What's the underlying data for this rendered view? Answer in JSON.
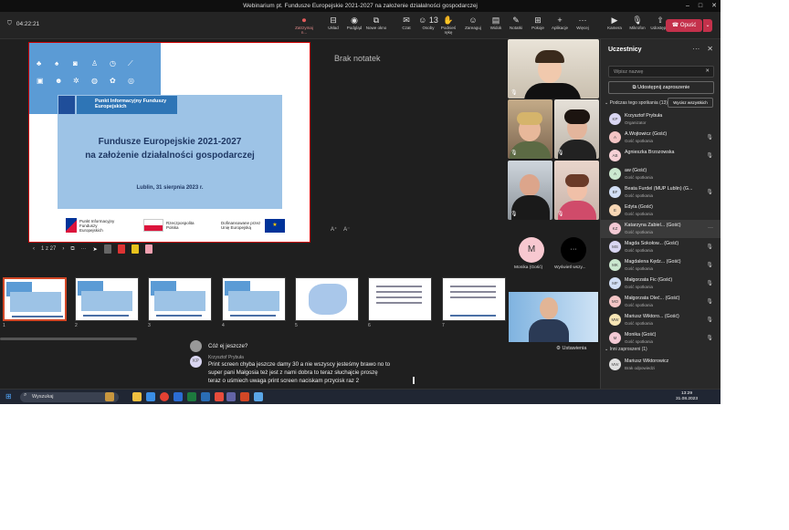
{
  "window": {
    "title": "Webinarium pt. Fundusze Europejskie 2021-2027 na założenie działalności gospodarczej"
  },
  "toolbar": {
    "timer": "04:22:21",
    "buttons": [
      {
        "label": "Zatrzymaj n...",
        "icon": "stop-recording-icon"
      },
      {
        "label": "Układ",
        "icon": "layout-icon"
      },
      {
        "label": "Podgląd",
        "icon": "preview-icon"
      },
      {
        "label": "Nowe okno",
        "icon": "new-window-icon"
      },
      {
        "label": "Czat",
        "icon": "chat-icon"
      },
      {
        "label": "Osoby",
        "icon": "people-icon",
        "badge": "13"
      },
      {
        "label": "Podnieś rękę",
        "icon": "raise-hand-icon"
      },
      {
        "label": "Zareaguj",
        "icon": "react-icon"
      },
      {
        "label": "Widok",
        "icon": "view-icon"
      },
      {
        "label": "Notatki",
        "icon": "notes-icon"
      },
      {
        "label": "Pokoje",
        "icon": "rooms-icon"
      },
      {
        "label": "Aplikacje",
        "icon": "apps-icon"
      },
      {
        "label": "Więcej",
        "icon": "more-icon"
      },
      {
        "label": "Kamera",
        "icon": "camera-icon"
      },
      {
        "label": "Mikrofon",
        "icon": "microphone-icon"
      },
      {
        "label": "Udostępnij",
        "icon": "share-icon"
      }
    ],
    "leave_label": "Opuść"
  },
  "slide": {
    "box_title": "Punkt Informacyjny Funduszy Europejskich",
    "title_line1": "Fundusze Europejskie 2021-2027",
    "title_line2": "na założenie działalności gospodarczej",
    "date": "Lublin, 31 sierpnia 2023 r.",
    "logo1": "Punkt Informacyjny Funduszy Europejskich",
    "logo2": "Rzeczpospolita Polska",
    "logo3": "Dofinansowane przez Unię Europejską"
  },
  "notes": {
    "text": "Brak notatek",
    "zoom_in": "A⁺",
    "zoom_out": "A⁻"
  },
  "slide_controls": {
    "page": "1 z 27"
  },
  "thumbnails": [
    "1",
    "2",
    "3",
    "4",
    "5",
    "6",
    "7"
  ],
  "tiles": [
    {
      "initial": "M",
      "name": "Monika (Gość)"
    },
    {
      "initial": "···",
      "name": "Wyświetl wszy..."
    }
  ],
  "chat": {
    "msg1": "Cóż ej jeszcze?",
    "author": "Krzysztof Prybuła",
    "author_initials": "KP",
    "msg2_line1": "Print screen chyba jeszcze damy 30 a nie wszyscy jesteśmy brawo no to",
    "msg2_line2": "super pani Małgosia też jest z nami dobra to teraz słuchajcie proszę",
    "msg2_line3": "teraz o uśmiech uwaga print screen naciskam przycisk raz 2",
    "settings": "Ustawienia"
  },
  "panel": {
    "title": "Uczestnicy",
    "search_placeholder": "Wpisz nazwę",
    "share_invite": "Udostępnij zaproszenie",
    "section_in_meeting": "Podczas tego spotkania (13)",
    "show_all": "Wycisz wszystkich",
    "participants": [
      {
        "initials": "KP",
        "name": "Krzysztof Prybuła",
        "role": "Organizator",
        "color": "#d9d6f2"
      },
      {
        "initials": "A",
        "name": "A.Wojtowicz (Gość)",
        "role": "Gość spotkania",
        "color": "#f4c5c5"
      },
      {
        "initials": "AB",
        "name": "Agnieszka Brzozowska",
        "role": "",
        "color": "#f7d1d6"
      },
      {
        "initials": "A",
        "name": "aw (Gość)",
        "role": "Gość spotkania",
        "color": "#cbe8cf"
      },
      {
        "initials": "BF",
        "name": "Beata Furdel (MUP Lublin) (G...",
        "role": "Gość spotkania",
        "color": "#d2dff5"
      },
      {
        "initials": "E",
        "name": "Edyta (Gość)",
        "role": "Gość spotkania",
        "color": "#f8d7b5"
      },
      {
        "initials": "KZ",
        "name": "Katarzyna Zabiel... (Gość)",
        "role": "Gość spotkania",
        "color": "#f3c9d4"
      },
      {
        "initials": "MS",
        "name": "Magda Sokołow... (Gość)",
        "role": "Gość spotkania",
        "color": "#d9d6f2"
      },
      {
        "initials": "MK",
        "name": "Magdalena Kędz... (Gość)",
        "role": "Gość spotkania",
        "color": "#cbe8cf"
      },
      {
        "initials": "MF",
        "name": "Małgorzata Fic (Gość)",
        "role": "Gość spotkania",
        "color": "#d2dff5"
      },
      {
        "initials": "MO",
        "name": "Małgorzata Oleć... (Gość)",
        "role": "Gość spotkania",
        "color": "#f4c5c5"
      },
      {
        "initials": "MW",
        "name": "Mariusz Wiktoro... (Gość)",
        "role": "Gość spotkania",
        "color": "#f8e6b5"
      },
      {
        "initials": "M",
        "name": "Monika (Gość)",
        "role": "Gość spotkania",
        "color": "#f3c9d4"
      }
    ],
    "section_invited": "Inni zaproszeni (1)",
    "invited": {
      "initials": "MW",
      "name": "Mariusz Wiktorowicz",
      "role": "Brak odpowiedzi",
      "color": "#e0e0e0"
    }
  },
  "taskbar": {
    "search": "Wyszukaj",
    "time": "13:29",
    "date": "31.08.2023"
  }
}
